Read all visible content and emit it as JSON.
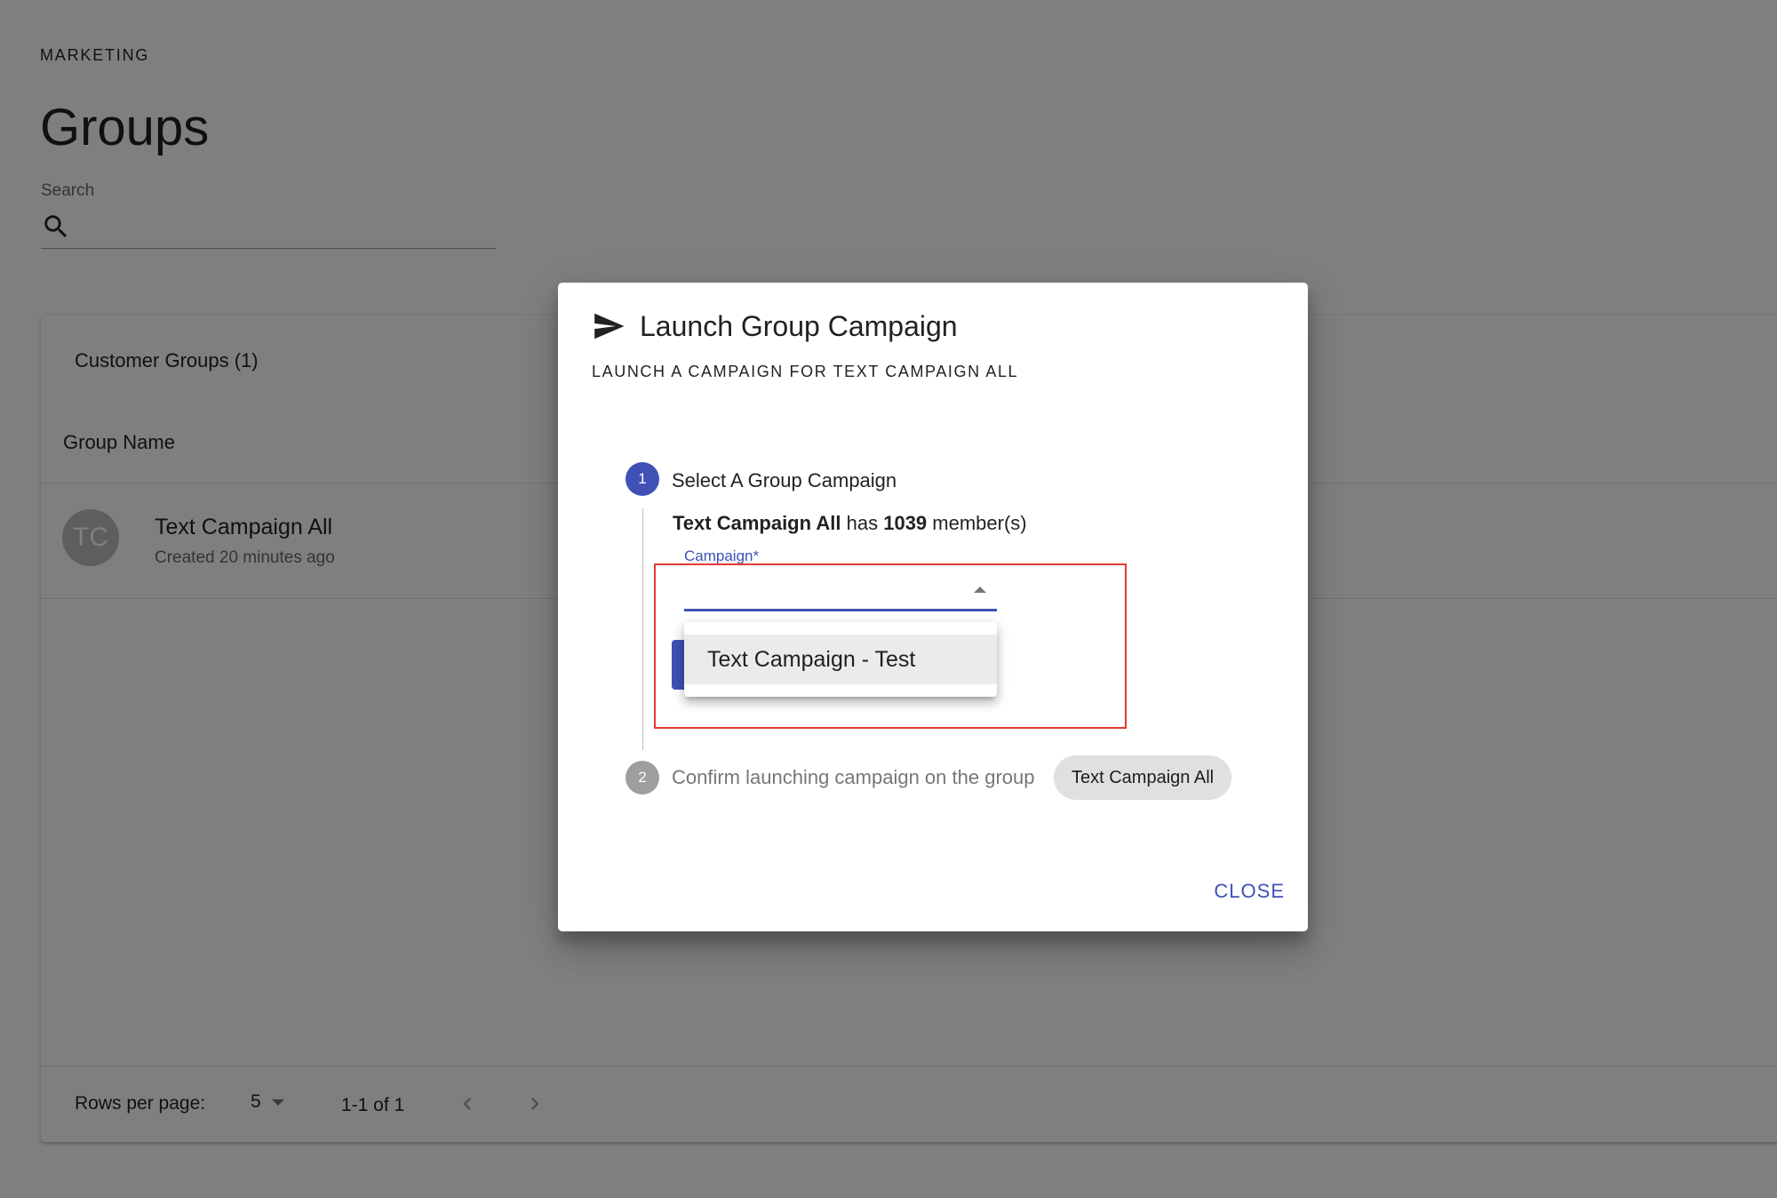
{
  "page": {
    "section": "MARKETING",
    "title": "Groups",
    "search": {
      "label": "Search",
      "value": ""
    }
  },
  "card": {
    "header": "Customer Groups (1)",
    "column": "Group Name",
    "rows": [
      {
        "initials": "TC",
        "name": "Text Campaign All",
        "created": "Created 20 minutes ago"
      }
    ],
    "footer": {
      "rows_per_page_label": "Rows per page:",
      "rows_per_page_value": "5",
      "range": "1-1 of 1"
    }
  },
  "dialog": {
    "title": "Launch Group Campaign",
    "subtitle": "LAUNCH A CAMPAIGN FOR TEXT CAMPAIGN ALL",
    "steps": [
      {
        "number": "1",
        "label": "Select A Group Campaign"
      },
      {
        "number": "2",
        "label": "Confirm launching campaign on the group"
      }
    ],
    "member_info": {
      "group": "Text Campaign All",
      "middle": "has",
      "count": "1039",
      "suffix": "member(s)"
    },
    "campaign_field": {
      "label": "Campaign",
      "required_mark": "*",
      "value": ""
    },
    "options": [
      "Text Campaign - Test"
    ],
    "group_chip": "Text Campaign All",
    "close_label": "CLOSE"
  },
  "colors": {
    "primary": "#3f51b5",
    "highlight": "#e53935",
    "backdrop": "rgba(0,0,0,0.5)"
  },
  "icons": {
    "search": "search-icon",
    "send": "send-icon",
    "prev": "chevron-left-icon",
    "next": "chevron-right-icon"
  }
}
